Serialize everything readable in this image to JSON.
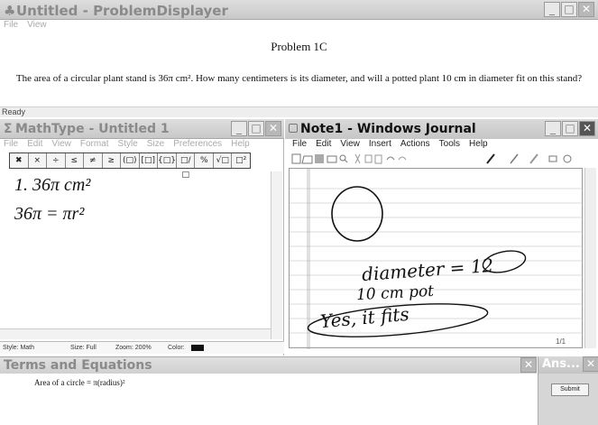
{
  "problem_displayer": {
    "title": "Untitled - ProblemDisplayer",
    "title_icon": "♣",
    "menu": [
      "File",
      "View"
    ],
    "heading": "Problem 1C",
    "text": "The area of a circular plant stand is 36π cm². How many centimeters is its diameter, and will a potted plant 10 cm in diameter fit on this stand?",
    "status": "Ready"
  },
  "mathtype": {
    "title": "MathType - Untitled 1",
    "title_icon": "Σ",
    "menu": [
      "File",
      "Edit",
      "View",
      "Format",
      "Style",
      "Size",
      "Preferences",
      "Help"
    ],
    "toolbar": [
      "✖",
      "×",
      "÷",
      "≤",
      "≠",
      "≥",
      "(□)",
      "[□]",
      "{□}",
      "□/□",
      "%",
      "√□",
      "□²"
    ],
    "line1": "1. 36π cm²",
    "line2": "36π = πr²",
    "status": {
      "style": "Style: Math",
      "size": "Size: Full",
      "zoom": "Zoom: 200%",
      "color": "Color:"
    },
    "color_swatch": "#111111"
  },
  "journal": {
    "title": "Note1 - Windows Journal",
    "menu": [
      "File",
      "Edit",
      "View",
      "Insert",
      "Actions",
      "Tools",
      "Help"
    ],
    "ink": {
      "line1": "diameter = 12",
      "line2": "10 cm pot",
      "line3": "Yes, it fits"
    },
    "page_number": "1/1"
  },
  "terms": {
    "title": "Terms and Equations",
    "formula": "Area of a circle = π(radius)²"
  },
  "answer": {
    "title": "Ans...",
    "submit_label": "Submit"
  },
  "window_buttons": {
    "minimize": "_",
    "maximize": "□",
    "close": "✕"
  }
}
